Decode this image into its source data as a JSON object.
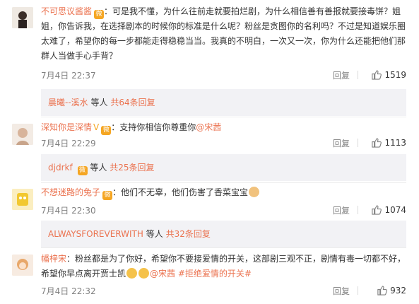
{
  "comments": [
    {
      "user": "不可思议酱酱",
      "text": "：可是我不懂，为什么往前走就要拍烂剧，为什么相信善有善报就要接毒饼？姐姐，你告诉我，在选择剧本的时候你的标准是什么呢？粉丝是贪图你的名利吗？不过是知道娱乐圈太难了，希望你的每一步都能走得稳稳当当。我真的不明白，一次又一次，你为什么还能把他们那群人当做手心手背？",
      "time": "7月4日 22:37",
      "reply": "回复",
      "likes": "1519",
      "sub_name": "晨曦--溪水",
      "sub_mid": "等人",
      "sub_more": "共64条回复"
    },
    {
      "user": "深知你是深情",
      "text": "：支持你相信你尊重你",
      "mention": "@宋茜",
      "time": "7月4日 22:29",
      "reply": "回复",
      "likes": "1113",
      "sub_name": "djdrkf",
      "sub_mid": "等人",
      "sub_more": "共25条回复"
    },
    {
      "user": "不想迷路的兔子",
      "text": "：他们不无辜，他们伤害了香菜宝宝",
      "time": "7月4日 22:30",
      "reply": "回复",
      "likes": "1074",
      "sub_name": "ALWAYSFOREVERWITH",
      "sub_mid": "等人",
      "sub_more": "共32条回复"
    },
    {
      "user": "幡梓宋",
      "text": "：粉丝都是为了你好，希望你不要接爱情的开关，这部剧三观不正，剧情有毒一切都不好，希望你早点离开贾士凯",
      "mention": "@宋茜",
      "tag": "#拒绝爱情的开关#",
      "time": "7月4日 22:32",
      "reply": "回复",
      "likes": "932"
    }
  ],
  "colors": {
    "accent": "#eb7350",
    "meta": "#808080",
    "sub_bg": "#f2f2f5"
  },
  "icons": {
    "thumb": "thumbs-up-icon",
    "vip": "vip-badge-icon"
  }
}
